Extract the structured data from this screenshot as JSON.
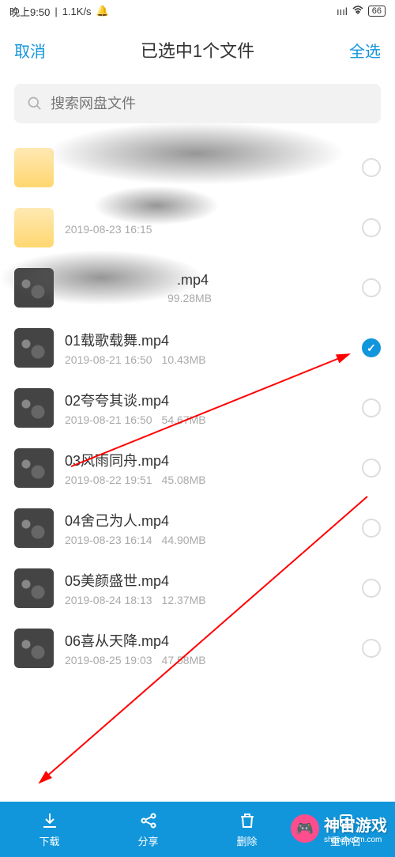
{
  "status": {
    "time": "晚上9:50",
    "speed": "1.1K/s",
    "battery": "66"
  },
  "header": {
    "cancel": "取消",
    "title": "已选中1个文件",
    "selectAll": "全选"
  },
  "search": {
    "placeholder": "搜索网盘文件"
  },
  "files": [
    {
      "name": "",
      "date": "",
      "size": "",
      "selected": false,
      "hidden": true
    },
    {
      "name": "",
      "date": "2019-08-23  16:15",
      "size": "",
      "selected": false,
      "hidden": true
    },
    {
      "name": "",
      "date": "",
      "size": "99.28MB",
      "selected": false,
      "hidden": true,
      "ext": ".mp4"
    },
    {
      "name": "01载歌载舞.mp4",
      "date": "2019-08-21  16:50",
      "size": "10.43MB",
      "selected": true
    },
    {
      "name": "02夸夸其谈.mp4",
      "date": "2019-08-21  16:50",
      "size": "54.67MB",
      "selected": false
    },
    {
      "name": "03风雨同舟.mp4",
      "date": "2019-08-22  19:51",
      "size": "45.08MB",
      "selected": false
    },
    {
      "name": "04舍己为人.mp4",
      "date": "2019-08-23  16:14",
      "size": "44.90MB",
      "selected": false
    },
    {
      "name": "05美颜盛世.mp4",
      "date": "2019-08-24  18:13",
      "size": "12.37MB",
      "selected": false
    },
    {
      "name": "06喜从天降.mp4",
      "date": "2019-08-25  19:03",
      "size": "47.58MB",
      "selected": false
    }
  ],
  "bottom": {
    "download": "下载",
    "share": "分享",
    "delete": "删除",
    "rename": "重命名"
  },
  "watermark": {
    "brand": "神宙游戏",
    "url": "shenzhoum.com"
  }
}
